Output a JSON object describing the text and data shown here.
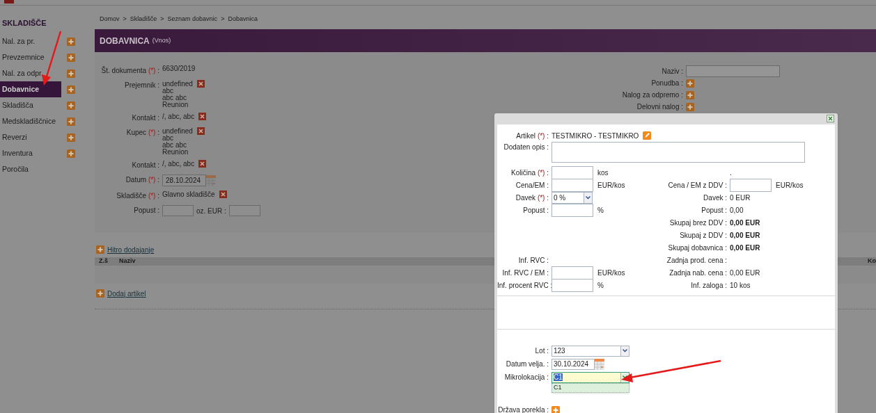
{
  "sidebar": {
    "title": "SKLADIŠČE",
    "items": [
      {
        "label": "Nal. za pr.",
        "selected": false,
        "add": true
      },
      {
        "label": "Prevzemnice",
        "selected": false,
        "add": true
      },
      {
        "label": "Nal. za odpr.",
        "selected": false,
        "add": true
      },
      {
        "label": "Dobavnice",
        "selected": true,
        "add": true
      },
      {
        "label": "Skladišča",
        "selected": false,
        "add": true
      },
      {
        "label": "Medskladiščnice",
        "selected": false,
        "add": true
      },
      {
        "label": "Reverzi",
        "selected": false,
        "add": true
      },
      {
        "label": "Inventura",
        "selected": false,
        "add": true
      },
      {
        "label": "Poročila",
        "selected": false,
        "add": false
      }
    ]
  },
  "breadcrumb": [
    {
      "label": "Domov"
    },
    {
      "sep": ">",
      "label": "Skladišče"
    },
    {
      "sep": ">",
      "label": "Seznam dobavnic"
    },
    {
      "sep": ">",
      "label": "Dobavnica"
    }
  ],
  "header": {
    "title": "DOBAVNICA",
    "subtitle": "(Vnos)"
  },
  "form_left": [
    {
      "kind": "text",
      "label": "Št. dokumenta",
      "mark": "(*)",
      "colon": ":",
      "lines": [
        "6630/2019"
      ]
    },
    {
      "kind": "removable",
      "label": "Prejemnik",
      "colon": ":",
      "lines": [
        "undefined",
        "abc",
        "abc abc",
        "Reunion"
      ]
    },
    {
      "kind": "removable",
      "label": "Kontakt",
      "colon": ":",
      "lines": [
        "/, abc, abc"
      ]
    },
    {
      "kind": "removable",
      "label": "Kupec",
      "mark": "(*)",
      "colon": ":",
      "lines": [
        "undefined",
        "abc",
        "abc abc",
        "Reunion"
      ]
    },
    {
      "kind": "removable",
      "label": "Kontakt",
      "colon": ":",
      "lines": [
        "/, abc, abc"
      ]
    },
    {
      "kind": "date",
      "label": "Datum",
      "mark": "(*)",
      "colon": ":",
      "value": "28.10.2024"
    },
    {
      "kind": "removable",
      "label": "Skladišče",
      "mark": "(*)",
      "colon": ":",
      "lines": [
        "Glavno skladišče"
      ]
    },
    {
      "kind": "pair",
      "label": "Popust",
      "colon": ":",
      "extra_label": "oz. EUR :"
    }
  ],
  "form_right": [
    {
      "kind": "input",
      "label": "Naziv :"
    },
    {
      "kind": "add",
      "label": "Ponudba :"
    },
    {
      "kind": "add",
      "label": "Nalog za odpremo :"
    },
    {
      "kind": "add",
      "label": "Delovni nalog :"
    }
  ],
  "quick_add": "Hitro dodajanje",
  "table": {
    "columns": [
      "Z.š",
      "Naziv",
      "Ko"
    ]
  },
  "add_article": "Dodaj artikel",
  "modal": {
    "article": {
      "label": "Artikel",
      "mark": "(*)",
      "colon": ":",
      "value": "TESTMIKRO - TESTMIKRO"
    },
    "description": {
      "label": "Dodaten opis :"
    },
    "rows": [
      {
        "left": {
          "kind": "input",
          "label": "Količina",
          "mark": "(*)",
          "colon": ":",
          "unit": "kos"
        },
        "right": {
          "kind": "note",
          "value": "."
        }
      },
      {
        "left": {
          "kind": "input",
          "label": "Cena/EM :",
          "unit": "EUR/kos"
        },
        "right": {
          "kind": "input",
          "label": "Cena / EM z DDV :",
          "unit": "EUR/kos"
        }
      },
      {
        "left": {
          "kind": "select",
          "label": "Davek",
          "mark": "(*)",
          "colon": ":",
          "value": "0 %"
        },
        "right": {
          "kind": "value",
          "label": "Davek :",
          "value": "0 EUR"
        }
      },
      {
        "left": {
          "kind": "input",
          "label": "Popust :",
          "unit": "%"
        },
        "right": {
          "kind": "value",
          "label": "Popust :",
          "value": "0,00"
        }
      },
      {
        "right": {
          "kind": "total",
          "label": "Skupaj brez DDV :",
          "value": "0,00 EUR"
        }
      },
      {
        "right": {
          "kind": "total",
          "label": "Skupaj z DDV :",
          "value": "0,00 EUR"
        }
      },
      {
        "right": {
          "kind": "total",
          "label": "Skupaj dobavnica :",
          "value": "0,00 EUR"
        }
      },
      {
        "left": {
          "kind": "label",
          "label": "Inf. RVC :"
        },
        "right": {
          "kind": "label",
          "label": "Zadnja prod. cena :"
        }
      },
      {
        "left": {
          "kind": "input",
          "label": "Inf. RVC / EM :",
          "unit": "EUR/kos"
        },
        "right": {
          "kind": "value",
          "label": "Zadnja nab. cena :",
          "value": "0,00 EUR"
        }
      },
      {
        "left": {
          "kind": "input",
          "label": "Inf. procent RVC :",
          "unit": "%"
        },
        "right": {
          "kind": "value",
          "label": "Inf. zaloga :",
          "value": "10 kos"
        }
      }
    ],
    "lot": {
      "label": "Lot :",
      "value": "123"
    },
    "expiry": {
      "label": "Datum velja. :",
      "value": "30.10.2024"
    },
    "location": {
      "label": "Mikrolokacija :",
      "value": "C1",
      "expanded": true,
      "options": [
        "C1"
      ]
    },
    "origin": {
      "label": "Država porekla :"
    }
  }
}
